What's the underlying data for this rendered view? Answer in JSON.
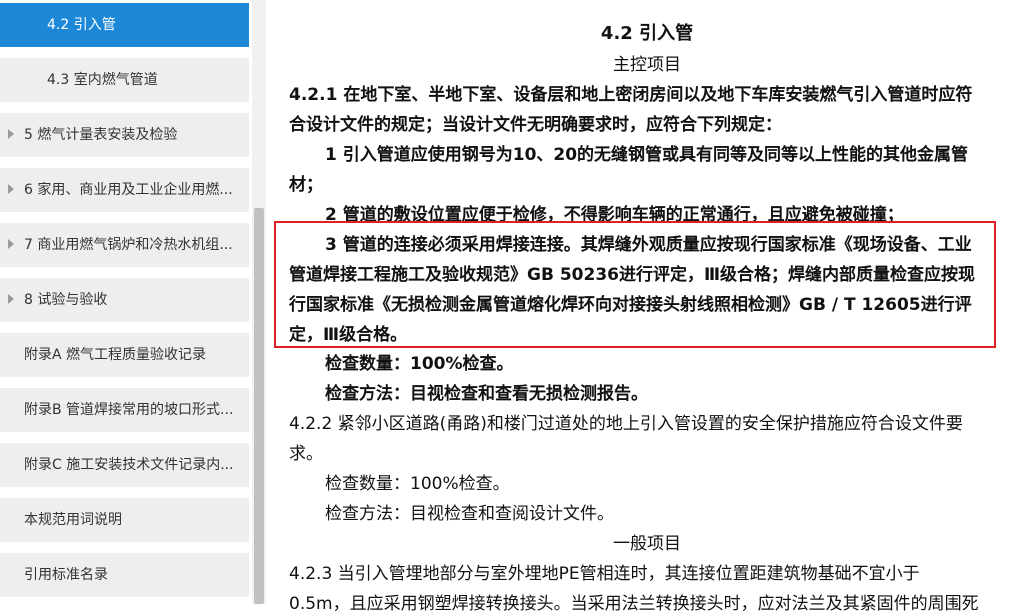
{
  "sidebar": {
    "items": [
      {
        "label": "4.2 引入管",
        "active": true
      },
      {
        "label": "4.3 室内燃气管道"
      },
      {
        "label": "5 燃气计量表安装及检验"
      },
      {
        "label": "6 家用、商业用及工业企业用燃..."
      },
      {
        "label": "7 商业用燃气锅炉和冷热水机组..."
      },
      {
        "label": "8 试验与验收"
      },
      {
        "label": "附录A 燃气工程质量验收记录"
      },
      {
        "label": "附录B 管道焊接常用的坡口形式..."
      },
      {
        "label": "附录C 施工安装技术文件记录内..."
      },
      {
        "label": "本规范用词说明"
      },
      {
        "label": "引用标准名录"
      }
    ]
  },
  "doc": {
    "section_title": "4.2   引入管",
    "main_items_heading": "主控项目",
    "general_items_heading": "一般项目",
    "lines": [
      "4.2.1   在地下室、半地下室、设备层和地上密闭房间以及地下车库安装燃气引入管道时应符",
      "合设计文件的规定；当设计文件无明确要求时，应符合下列规定：",
      "1   引入管道应使用钢号为10、20的无缝钢管或具有同等及同等以上性能的其他金属管",
      "材；",
      "2   管道的敷设位置应便于检修，不得影响车辆的正常通行，且应避免被碰撞；",
      "3   管道的连接必须采用焊接连接。其焊缝外观质量应按现行国家标准《现场设备、工业",
      "管道焊接工程施工及验收规范》GB  50236进行评定，Ⅲ级合格；焊缝内部质量检查应按现",
      "行国家标准《无损检测金属管道熔化焊环向对接接头射线照相检测》GB / T  12605进行评",
      "定，Ⅲ级合格。",
      "检查数量：100%检查。",
      "检查方法：目视检查和查看无损检测报告。",
      "4.2.2   紧邻小区道路(甬路)和楼门过道处的地上引入管设置的安全保护措施应符合设文件要",
      "求。",
      "检查数量：100%检查。",
      "检查方法：目视检查和查阅设计文件。",
      "4.2.3   当引入管埋地部分与室外埋地PE管相连时，其连接位置距建筑物基础不宜小于",
      "0.5m，且应采用钢塑焊接转换接头。当采用法兰转换接头时，应对法兰及其紧固件的周围死"
    ]
  },
  "colors": {
    "active_nav_bg": "#1e88d8",
    "nav_bg": "#eeeeee",
    "highlight_border": "#e02020"
  }
}
